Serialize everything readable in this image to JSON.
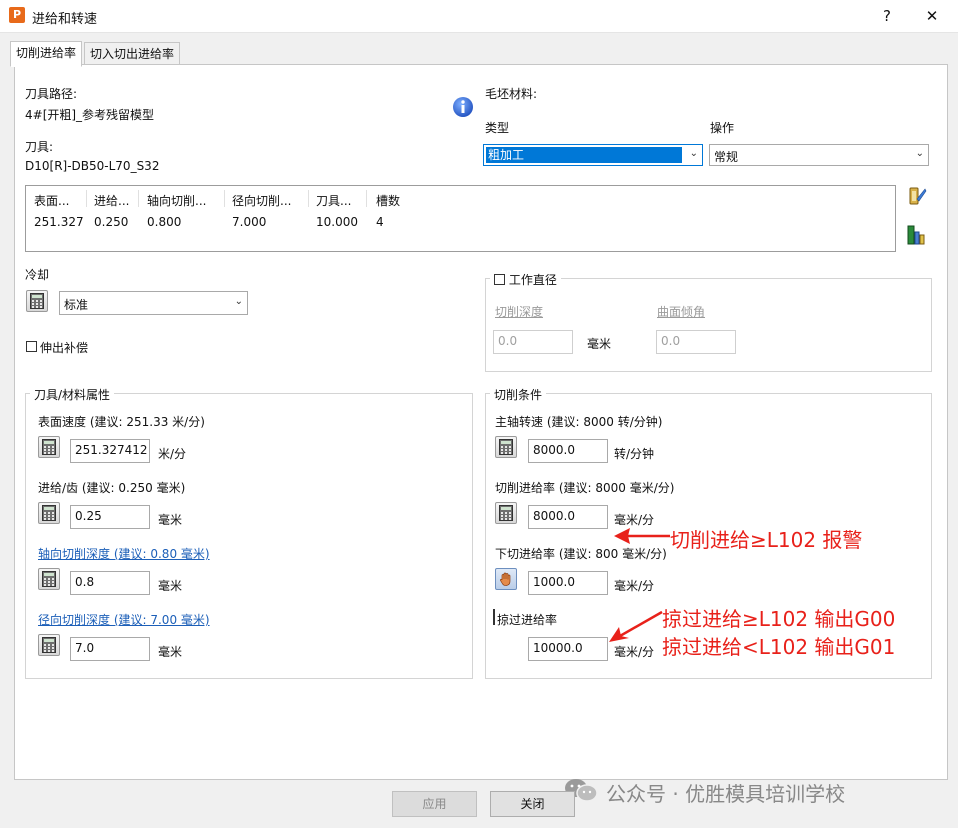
{
  "window": {
    "title": "进给和转速",
    "help_btn": "?",
    "close_btn": "✕",
    "app_icon_letter": "P"
  },
  "tabs": [
    {
      "label": "切削进给率",
      "active": true
    },
    {
      "label": "切入切出进给率",
      "active": false
    }
  ],
  "toolpath": {
    "label": "刀具路径:",
    "value": "4#[开粗]_参考残留模型"
  },
  "tool": {
    "label": "刀具:",
    "value": "D10[R]-DB50-L70_S32"
  },
  "stock": {
    "label": "毛坯材料:",
    "type_label": "类型",
    "type_value": "粗加工",
    "op_label": "操作",
    "op_value": "常规"
  },
  "tool_table": {
    "headers": [
      "表面...",
      "进给...",
      "轴向切削...",
      "径向切削...",
      "刀具...",
      "槽数"
    ],
    "row": [
      "251.327",
      "0.250",
      "0.800",
      "7.000",
      "10.000",
      "4"
    ]
  },
  "coolant": {
    "label": "冷却",
    "value": "标准"
  },
  "overhang": {
    "label": "伸出补偿"
  },
  "work_diameter": {
    "label": "工作直径",
    "depth_label": "切削深度",
    "depth_value": "0.0",
    "unit": "毫米",
    "angle_label": "曲面倾角",
    "angle_value": "0.0"
  },
  "tool_props": {
    "title": "刀具/材料属性",
    "surface_speed_label": "表面速度 (建议: 251.33 米/分)",
    "surface_speed_value": "251.327412",
    "surface_speed_unit": "米/分",
    "feed_tooth_label": "进给/齿 (建议: 0.250 毫米)",
    "feed_tooth_value": "0.25",
    "feed_tooth_unit": "毫米",
    "axial_label": "轴向切削深度 (建议: 0.80 毫米)",
    "axial_value": "0.8",
    "axial_unit": "毫米",
    "radial_label": "径向切削深度 (建议: 7.00 毫米)",
    "radial_value": "7.0",
    "radial_unit": "毫米"
  },
  "cut_cond": {
    "title": "切削条件",
    "spindle_label": "主轴转速 (建议: 8000 转/分钟)",
    "spindle_value": "8000.0",
    "spindle_unit": "转/分钟",
    "cut_feed_label": "切削进给率 (建议: 8000 毫米/分)",
    "cut_feed_value": "8000.0",
    "cut_feed_unit": "毫米/分",
    "plunge_label": "下切进给率 (建议: 800 毫米/分)",
    "plunge_value": "1000.0",
    "plunge_unit": "毫米/分",
    "skim_label": "掠过进给率",
    "skim_value": "10000.0",
    "skim_unit": "毫米/分"
  },
  "annotations": {
    "a1": "切削进给≥L102 报警",
    "a2": "掠过进给≥L102 输出G00",
    "a3": "掠过进给<L102 输出G01"
  },
  "buttons": {
    "apply": "应用",
    "close": "关闭"
  },
  "watermark": "公众号 · 优胜模具培训学校",
  "colors": {
    "selection": "#0078d7",
    "annotation": "#e8211a",
    "link": "#1c5fb8"
  }
}
